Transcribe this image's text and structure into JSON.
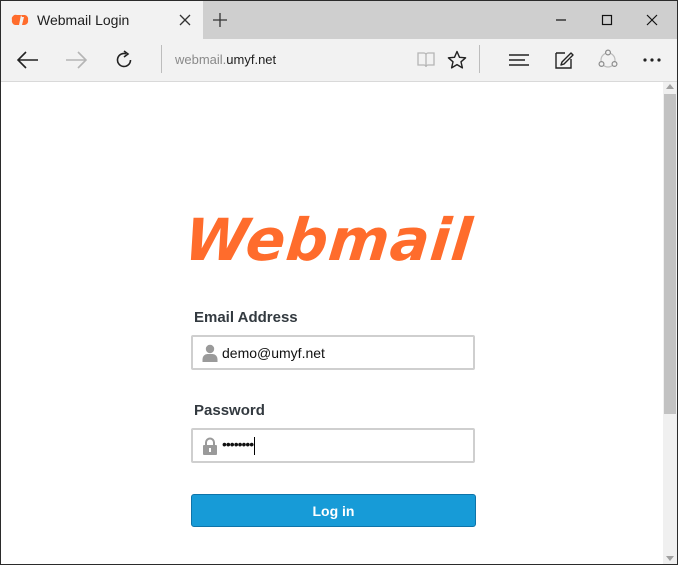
{
  "tab": {
    "title": "Webmail Login"
  },
  "address_bar": {
    "prefix": "webmail.",
    "domain": "umyf.net"
  },
  "logo": {
    "text": "Webmail"
  },
  "form": {
    "email_label": "Email Address",
    "email_value": "demo@umyf.net",
    "password_label": "Password",
    "password_value": "••••••••",
    "login_label": "Log in"
  },
  "colors": {
    "brand_orange": "#ff6c2c",
    "button_blue": "#179bd7"
  },
  "icons": {
    "favicon": "cpanel-icon",
    "tab_close": "close-icon",
    "new_tab": "plus-icon",
    "minimize": "minimize-icon",
    "maximize": "maximize-icon",
    "close_window": "close-window-icon",
    "back": "arrow-left-icon",
    "forward": "arrow-right-icon",
    "refresh": "refresh-icon",
    "reading_view": "book-icon",
    "favorite": "star-icon",
    "hub": "hub-icon",
    "web_note": "note-icon",
    "share": "share-icon",
    "more": "more-icon",
    "user": "user-icon",
    "lock": "lock-icon"
  }
}
